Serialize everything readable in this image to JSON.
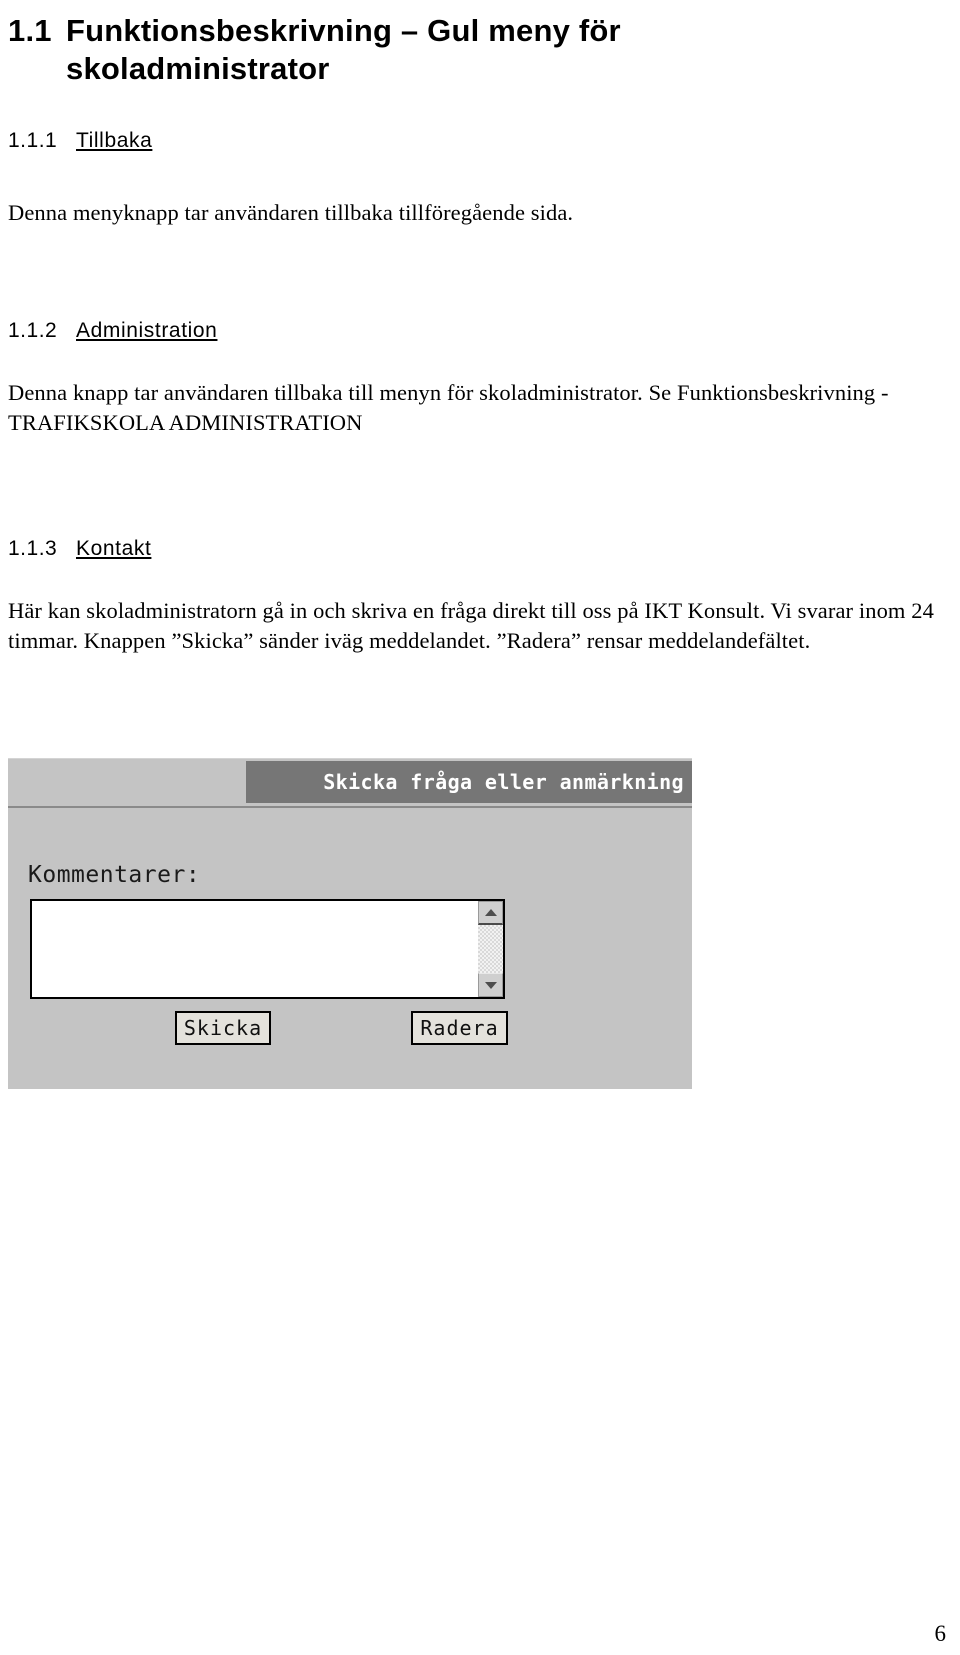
{
  "document": {
    "heading_main": {
      "number": "1.1",
      "text_line1": "Funktionsbeskrivning – Gul meny för",
      "text_line2": "skoladministrator"
    },
    "sections": [
      {
        "number": "1.1.1",
        "title": "Tillbaka",
        "body": "Denna menyknapp tar användaren tillbaka tillföregående sida."
      },
      {
        "number": "1.1.2",
        "title": "Administration",
        "body": "Denna knapp tar användaren tillbaka till menyn för skoladministrator. Se Funktionsbeskrivning - TRAFIKSKOLA ADMINISTRATION"
      },
      {
        "number": "1.1.3",
        "title": "Kontakt",
        "body": "Här kan skoladministratorn gå in och skriva en fråga direkt till oss på IKT Konsult. Vi svarar inom 24 timmar. Knappen ”Skicka” sänder iväg meddelandet. ”Radera” rensar meddelandefältet."
      }
    ],
    "page_number": "6"
  },
  "screenshot": {
    "titlebar": {
      "title": "Skicka fråga eller anmärkning"
    },
    "form": {
      "comment_label": "Kommentarer:",
      "comment_value": "",
      "comment_placeholder": ""
    },
    "buttons": {
      "submit_label": "Skicka",
      "clear_label": "Radera"
    },
    "scrollbar": {
      "up_icon": "triangle-up-icon",
      "down_icon": "triangle-down-icon"
    },
    "colors": {
      "panel_background": "#c4c4c4",
      "titlebar_background": "#767676",
      "titlebar_text": "#ffffff",
      "button_face": "#e4e2dc",
      "field_background": "#ffffff"
    }
  }
}
